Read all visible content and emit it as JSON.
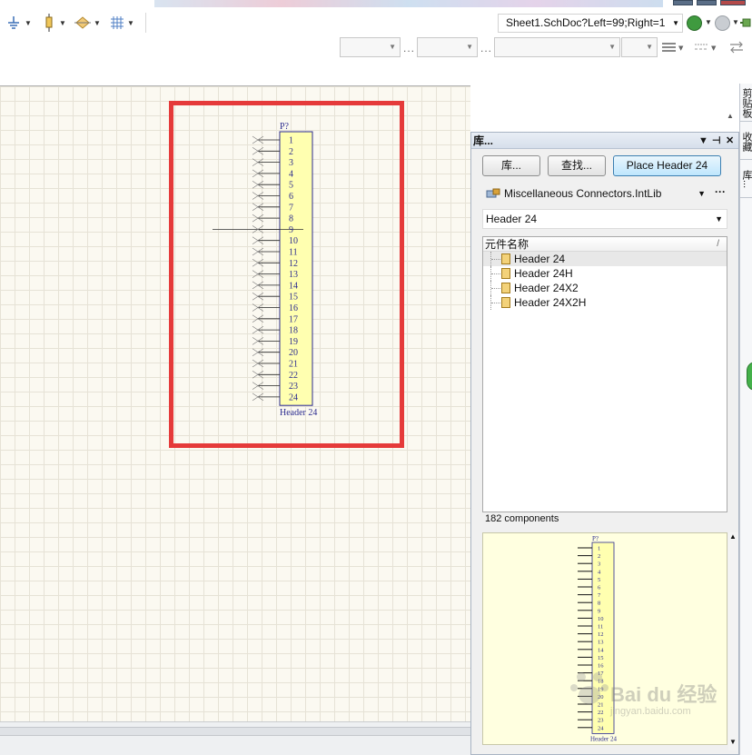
{
  "toolbar": {
    "document_title": "Sheet1.SchDoc?Left=99;Right=1",
    "icons": [
      "power-ground-icon",
      "resistor-icon",
      "port-diamond-icon",
      "grid-icon",
      "back-nav-icon",
      "forward-nav-icon",
      "plug-icon",
      "line-style-icon",
      "dash-style-icon",
      "swap-icon"
    ]
  },
  "canvas": {
    "designator": "P?",
    "comment": "Header 24",
    "pins": [
      "1",
      "2",
      "3",
      "4",
      "5",
      "6",
      "7",
      "8",
      "9",
      "10",
      "11",
      "12",
      "13",
      "14",
      "15",
      "16",
      "17",
      "18",
      "19",
      "20",
      "21",
      "22",
      "23",
      "24"
    ],
    "highlight_color": "#e53a3a",
    "body_color": "#ffffb0"
  },
  "library_panel": {
    "title": "库...",
    "buttons": {
      "libraries": "库...",
      "search": "查找...",
      "place": "Place Header 24"
    },
    "library_name": "Miscellaneous Connectors.IntLib",
    "filter_value": "Header 24",
    "column_header": "元件名称",
    "sort_mark": "/",
    "components": [
      "Header 24",
      "Header 24H",
      "Header 24X2",
      "Header 24X2H"
    ],
    "selected_component": "Header 24",
    "count_text": "182 components",
    "preview": {
      "designator": "P?",
      "comment": "Header 24"
    }
  },
  "right_tabs": [
    "剪贴板",
    "收藏",
    "库..."
  ],
  "watermark": {
    "logo_text": "Bai du 经验",
    "url": "jingyan.baidu.com"
  }
}
